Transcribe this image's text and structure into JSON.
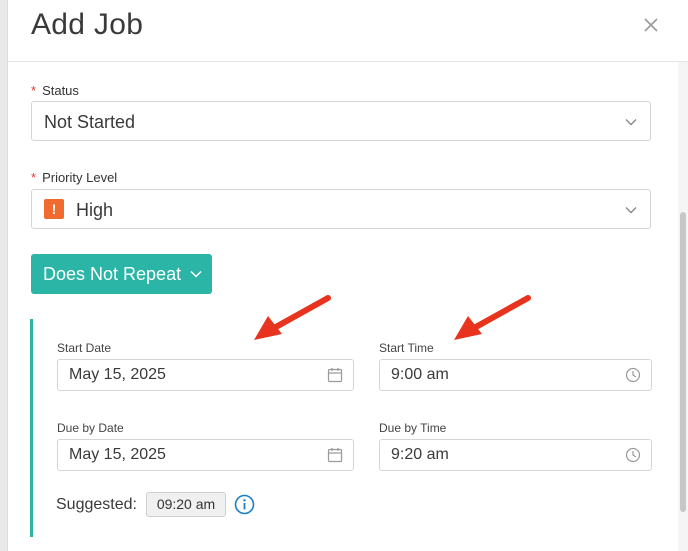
{
  "modal": {
    "title": "Add Job"
  },
  "status": {
    "required_mark": "*",
    "label": "Status",
    "value": "Not Started"
  },
  "priority": {
    "required_mark": "*",
    "label": "Priority Level",
    "value": "High",
    "icon_glyph": "!",
    "icon_color": "#f26b2e"
  },
  "repeat": {
    "label": "Does Not Repeat",
    "color": "#2bb5a6"
  },
  "schedule": {
    "start_date_label": "Start Date",
    "start_date_value": "May 15, 2025",
    "start_time_label": "Start Time",
    "start_time_value": "9:00 am",
    "due_date_label": "Due by Date",
    "due_date_value": "May 15, 2025",
    "due_time_label": "Due by Time",
    "due_time_value": "9:20 am",
    "suggested_label": "Suggested:",
    "suggested_value": "09:20 am"
  },
  "annotations": {
    "arrow_color": "#e8331f"
  },
  "icons": {
    "close": "close-icon",
    "chevron": "chevron-down-icon",
    "calendar": "calendar-icon",
    "clock": "clock-icon",
    "info": "info-icon"
  }
}
